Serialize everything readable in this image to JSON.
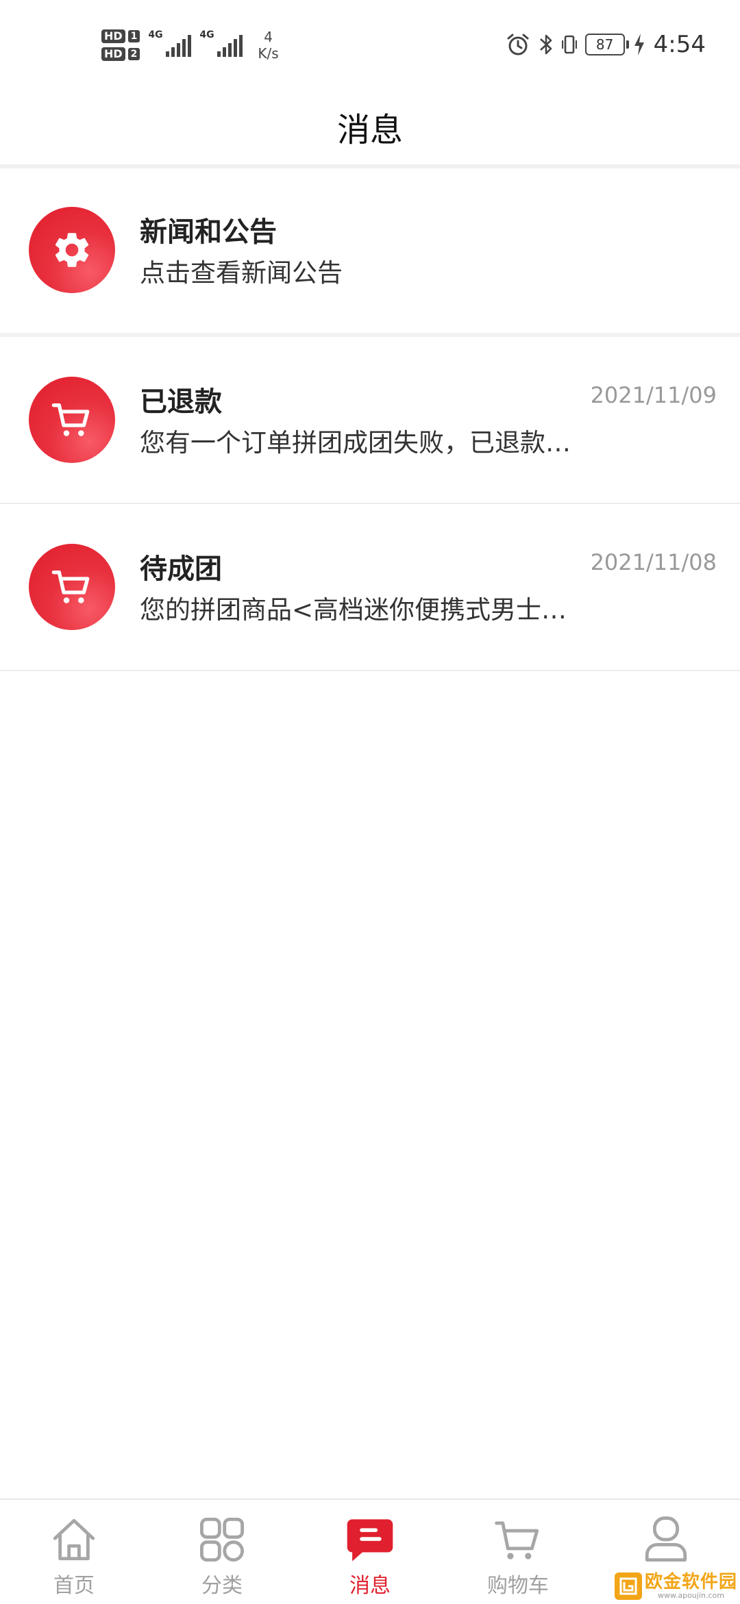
{
  "status_bar": {
    "sim1_badge": "HD",
    "sim1_num": "1",
    "sim2_badge": "HD",
    "sim2_num": "2",
    "signal1_label": "4G",
    "signal2_label": "4G",
    "speed_value": "4",
    "speed_unit": "K/s",
    "battery": "87",
    "time": "4:54",
    "icons": [
      "alarm-icon",
      "bluetooth-icon",
      "vibrate-icon",
      "battery-icon",
      "charging-icon"
    ]
  },
  "header": {
    "title": "消息"
  },
  "messages": [
    {
      "icon": "gear-icon",
      "title": "新闻和公告",
      "body": "点击查看新闻公告",
      "date": ""
    },
    {
      "icon": "cart-icon",
      "title": "已退款",
      "body": "您有一个订单拼团成团失败，已退款…",
      "date": "2021/11/09"
    },
    {
      "icon": "cart-icon",
      "title": "待成团",
      "body": "您的拼团商品<高档迷你便携式男士…",
      "date": "2021/11/08"
    }
  ],
  "bottom_nav": {
    "items": [
      {
        "label": "首页",
        "icon": "home-icon",
        "active": false
      },
      {
        "label": "分类",
        "icon": "category-grid-icon",
        "active": false
      },
      {
        "label": "消息",
        "icon": "message-icon",
        "active": true
      },
      {
        "label": "购物车",
        "icon": "cart-icon",
        "active": false
      },
      {
        "label": "",
        "icon": "user-icon",
        "active": false
      }
    ]
  },
  "watermark": {
    "main": "欧金软件园",
    "sub": "www.apoujin.com"
  },
  "colors": {
    "accent": "#e0202e",
    "inactive": "#a0a0a0",
    "divider": "#f1f1f1"
  }
}
